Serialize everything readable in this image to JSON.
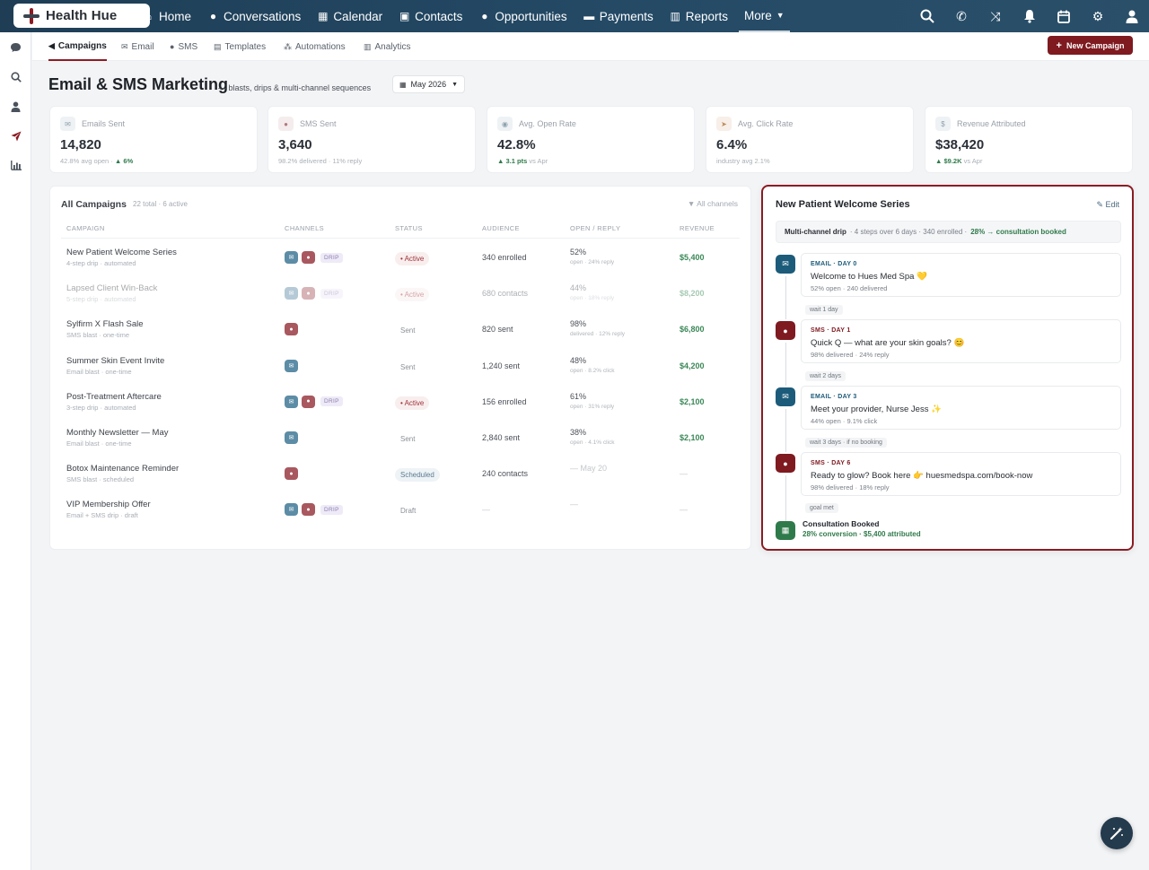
{
  "brand": {
    "name": "Health Hue"
  },
  "topnav": {
    "items": [
      {
        "label": "Home",
        "icon": "home-icon"
      },
      {
        "label": "Conversations",
        "icon": "chat-icon"
      },
      {
        "label": "Calendar",
        "icon": "calendar-icon"
      },
      {
        "label": "Contacts",
        "icon": "contact-card-icon"
      },
      {
        "label": "Opportunities",
        "icon": "lightbulb-icon"
      },
      {
        "label": "Payments",
        "icon": "credit-card-icon"
      },
      {
        "label": "Reports",
        "icon": "bar-chart-icon"
      }
    ],
    "more_label": "More",
    "right_icons": [
      "search-icon",
      "phone-icon",
      "shuffle-icon",
      "bell-icon",
      "calendar-icon",
      "gear-icon",
      "user-icon"
    ]
  },
  "sidebar": {
    "icons": [
      "chat-icon",
      "search-icon",
      "user-icon",
      "send-icon",
      "bar-chart-icon"
    ]
  },
  "subnav": {
    "tabs": [
      {
        "label": "Campaigns",
        "icon": "megaphone-icon"
      },
      {
        "label": "Email",
        "icon": "envelope-icon"
      },
      {
        "label": "SMS",
        "icon": "chat-icon"
      },
      {
        "label": "Templates",
        "icon": "template-icon"
      },
      {
        "label": "Automations",
        "icon": "automation-icon"
      },
      {
        "label": "Analytics",
        "icon": "bar-chart-icon"
      }
    ],
    "new_campaign_label": "New Campaign"
  },
  "header": {
    "title": "Email & SMS Marketing",
    "subtitle": "— blasts, drips & multi-channel sequences",
    "month": "May 2026"
  },
  "stats": [
    {
      "label": "Emails Sent",
      "value": "14,820",
      "sub": "42.8% avg open ·",
      "delta": "▲ 6%",
      "icon": "envelope-icon"
    },
    {
      "label": "SMS Sent",
      "value": "3,640",
      "sub": "98.2% delivered · 11% reply",
      "delta": "",
      "icon": "chat-icon"
    },
    {
      "label": "Avg. Open Rate",
      "value": "42.8%",
      "sub": "vs Apr",
      "delta": "▲ 3.1 pts",
      "icon": "eye-icon"
    },
    {
      "label": "Avg. Click Rate",
      "value": "6.4%",
      "sub": "industry avg 2.1%",
      "delta": "",
      "icon": "cursor-icon"
    },
    {
      "label": "Revenue Attributed",
      "value": "$38,420",
      "sub": "vs Apr",
      "delta": "▲ $9.2K",
      "icon": "dollar-icon"
    }
  ],
  "campaigns": {
    "title": "All Campaigns",
    "count": "22 total · 6 active",
    "filter": "All channels",
    "columns": [
      "Campaign",
      "Channels",
      "Status",
      "Audience",
      "Open / Reply",
      "Revenue"
    ],
    "drip_badge": "DRIP",
    "rows": [
      {
        "name": "New Patient Welcome Series",
        "meta": "4-step drip · automated",
        "email": true,
        "sms": true,
        "drip": true,
        "status": "• Active",
        "status_kind": "active",
        "audience": "340 enrolled",
        "open": "52%",
        "open_sub": "open · 24% reply",
        "revenue": "$5,400",
        "faded": false
      },
      {
        "name": "Lapsed Client Win-Back",
        "meta": "5-step drip · automated",
        "email": true,
        "sms": true,
        "drip": true,
        "status": "• Active",
        "status_kind": "active",
        "audience": "680 contacts",
        "open": "44%",
        "open_sub": "open · 18% reply",
        "revenue": "$8,200",
        "faded": true
      },
      {
        "name": "Sylfirm X Flash Sale",
        "meta": "SMS blast · one-time",
        "email": false,
        "sms": true,
        "drip": false,
        "status": "Sent",
        "status_kind": "sent",
        "audience": "820 sent",
        "open": "98%",
        "open_sub": "delivered · 12% reply",
        "revenue": "$6,800",
        "faded": false
      },
      {
        "name": "Summer Skin Event Invite",
        "meta": "Email blast · one-time",
        "email": true,
        "sms": false,
        "drip": false,
        "status": "Sent",
        "status_kind": "sent",
        "audience": "1,240 sent",
        "open": "48%",
        "open_sub": "open · 8.2% click",
        "revenue": "$4,200",
        "faded": false
      },
      {
        "name": "Post-Treatment Aftercare",
        "meta": "3-step drip · automated",
        "email": true,
        "sms": true,
        "drip": true,
        "status": "• Active",
        "status_kind": "active",
        "audience": "156 enrolled",
        "open": "61%",
        "open_sub": "open · 31% reply",
        "revenue": "$2,100",
        "faded": false
      },
      {
        "name": "Monthly Newsletter — May",
        "meta": "Email blast · one-time",
        "email": true,
        "sms": false,
        "drip": false,
        "status": "Sent",
        "status_kind": "sent",
        "audience": "2,840 sent",
        "open": "38%",
        "open_sub": "open · 4.1% click",
        "revenue": "$2,100",
        "faded": false
      },
      {
        "name": "Botox Maintenance Reminder",
        "meta": "SMS blast · scheduled",
        "email": false,
        "sms": true,
        "drip": false,
        "status": "Scheduled",
        "status_kind": "scheduled",
        "audience": "240 contacts",
        "open": "— May 20",
        "open_sub": "",
        "revenue": "—",
        "faded": false
      },
      {
        "name": "VIP Membership Offer",
        "meta": "Email + SMS drip · draft",
        "email": true,
        "sms": true,
        "drip": true,
        "status": "Draft",
        "status_kind": "draft",
        "audience": "—",
        "open": "—",
        "open_sub": "",
        "revenue": "—",
        "faded": false
      }
    ]
  },
  "series": {
    "title": "New Patient Welcome Series",
    "edit_label": "Edit",
    "summary_bold": "Multi-channel drip",
    "summary_text": "· 4 steps over 6 days · 340 enrolled ·",
    "summary_goal": "28% → consultation booked",
    "steps": [
      {
        "kind": "email",
        "tag": "EMAIL · DAY 0",
        "msg": "Welcome to Hues Med Spa 💛",
        "metrics": "52% open · 240 delivered",
        "wait_after": "wait 1 day"
      },
      {
        "kind": "sms",
        "tag": "SMS · DAY 1",
        "msg": "Quick Q — what are your skin goals? 😊",
        "metrics": "98% delivered · 24% reply",
        "wait_after": "wait 2 days"
      },
      {
        "kind": "email",
        "tag": "EMAIL · DAY 3",
        "msg": "Meet your provider, Nurse Jess ✨",
        "metrics": "44% open · 9.1% click",
        "wait_after": "wait 3 days · if no booking"
      },
      {
        "kind": "sms",
        "tag": "SMS · DAY 6",
        "msg": "Ready to glow? Book here 👉 huesmedspa.com/book-now",
        "metrics": "98% delivered · 18% reply",
        "wait_after": "goal met"
      }
    ],
    "goal_title": "Consultation Booked",
    "goal_sub": "28% conversion · $5,400 attributed"
  }
}
